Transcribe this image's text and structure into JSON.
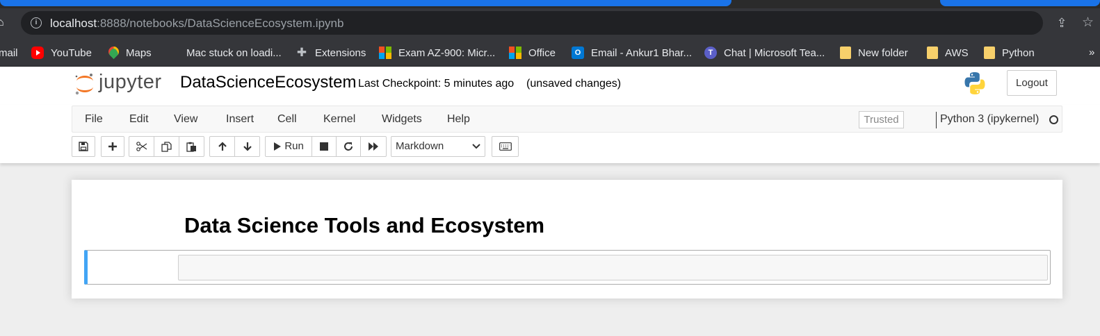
{
  "browser": {
    "url_host": "localhost",
    "url_path": ":8888/notebooks/DataScienceEcosystem.ipynb",
    "bookmarks": [
      {
        "label": "mail",
        "icon": "mail-icon"
      },
      {
        "label": "YouTube",
        "icon": "youtube-icon"
      },
      {
        "label": "Maps",
        "icon": "maps-icon"
      },
      {
        "label": "Mac stuck on loadi...",
        "icon": "apple-icon"
      },
      {
        "label": "Extensions",
        "icon": "puzzle-icon"
      },
      {
        "label": "Exam AZ-900: Micr...",
        "icon": "microsoft-icon"
      },
      {
        "label": "Office",
        "icon": "microsoft-icon"
      },
      {
        "label": "Email - Ankur1 Bhar...",
        "icon": "outlook-icon"
      },
      {
        "label": "Chat | Microsoft Tea...",
        "icon": "teams-icon"
      },
      {
        "label": "New folder",
        "icon": "folder-icon"
      },
      {
        "label": "AWS",
        "icon": "folder-icon"
      },
      {
        "label": "Python",
        "icon": "folder-icon"
      }
    ]
  },
  "header": {
    "logo_text": "jupyter",
    "notebook_name": "DataScienceEcosystem",
    "checkpoint": "Last Checkpoint: 5 minutes ago",
    "unsaved": "(unsaved changes)",
    "logout_label": "Logout"
  },
  "menubar": {
    "items": [
      "File",
      "Edit",
      "View",
      "Insert",
      "Cell",
      "Kernel",
      "Widgets",
      "Help"
    ],
    "trusted_label": "Trusted",
    "kernel_name": "Python 3 (ipykernel)"
  },
  "toolbar": {
    "run_label": "Run",
    "cell_type": "Markdown"
  },
  "notebook": {
    "heading": "Data Science Tools and Ecosystem"
  },
  "colors": {
    "selected_cell_border": "#42a5f5",
    "jupyter_orange": "#f37726"
  }
}
